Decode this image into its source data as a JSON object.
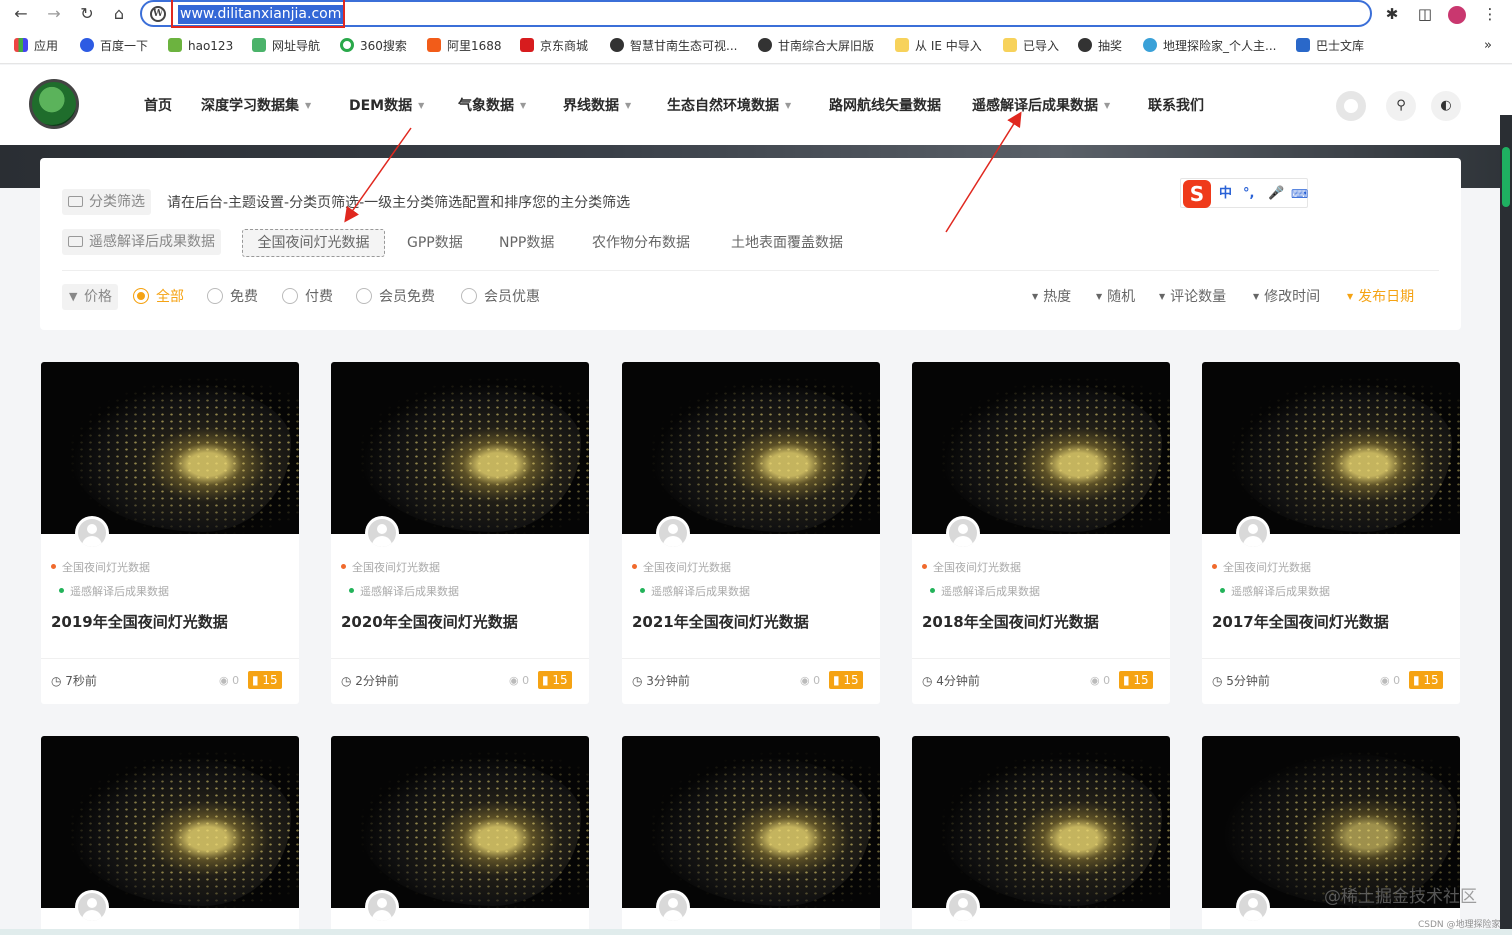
{
  "browser": {
    "url": "www.dilitanxianjia.com",
    "bookmarks": [
      "应用",
      "百度一下",
      "hao123",
      "网址导航",
      "360搜索",
      "阿里1688",
      "京东商城",
      "智慧甘南生态可视...",
      "甘南综合大屏旧版",
      "从 IE 中导入",
      "已导入",
      "抽奖",
      "地理探险家_个人主...",
      "巴士文库"
    ],
    "more": "»"
  },
  "header": {
    "menu": [
      {
        "label": "首页",
        "dropdown": false
      },
      {
        "label": "深度学习数据集",
        "dropdown": true
      },
      {
        "label": "DEM数据",
        "dropdown": true
      },
      {
        "label": "气象数据",
        "dropdown": true
      },
      {
        "label": "界线数据",
        "dropdown": true
      },
      {
        "label": "生态自然环境数据",
        "dropdown": true
      },
      {
        "label": "路网航线矢量数据",
        "dropdown": false
      },
      {
        "label": "遥感解译后成果数据",
        "dropdown": true
      },
      {
        "label": "联系我们",
        "dropdown": false
      }
    ]
  },
  "filter": {
    "category_chip": "分类筛选",
    "hint": "请在后台-主题设置-分类页筛选-一级主分类筛选配置和排序您的主分类筛选",
    "parent_chip": "遥感解译后成果数据",
    "categories": [
      "全国夜间灯光数据",
      "GPP数据",
      "NPP数据",
      "农作物分布数据",
      "土地表面覆盖数据"
    ],
    "price_chip": "价格",
    "price_options": [
      "全部",
      "免费",
      "付费",
      "会员免费",
      "会员优惠"
    ],
    "sort_options": [
      "热度",
      "随机",
      "评论数量",
      "修改时间",
      "发布日期"
    ]
  },
  "ime": {
    "zh": "中",
    "punct": "°,",
    "logo": "S"
  },
  "cards": [
    {
      "tag1": "全国夜间灯光数据",
      "tag2": "遥感解译后成果数据",
      "title": "2019年全国夜间灯光数据",
      "time": "7秒前",
      "views": "0",
      "price": "15"
    },
    {
      "tag1": "全国夜间灯光数据",
      "tag2": "遥感解译后成果数据",
      "title": "2020年全国夜间灯光数据",
      "time": "2分钟前",
      "views": "0",
      "price": "15"
    },
    {
      "tag1": "全国夜间灯光数据",
      "tag2": "遥感解译后成果数据",
      "title": "2021年全国夜间灯光数据",
      "time": "3分钟前",
      "views": "0",
      "price": "15"
    },
    {
      "tag1": "全国夜间灯光数据",
      "tag2": "遥感解译后成果数据",
      "title": "2018年全国夜间灯光数据",
      "time": "4分钟前",
      "views": "0",
      "price": "15"
    },
    {
      "tag1": "全国夜间灯光数据",
      "tag2": "遥感解译后成果数据",
      "title": "2017年全国夜间灯光数据",
      "time": "5分钟前",
      "views": "0",
      "price": "15"
    }
  ],
  "watermark": "@稀土掘金技术社区",
  "csdn_mark": "CSDN @地理探险家",
  "colors": {
    "accent": "#f5a314",
    "annotation": "#e0281f",
    "tag_dot_1": "#f06a2d",
    "tag_dot_2": "#23b35a"
  }
}
